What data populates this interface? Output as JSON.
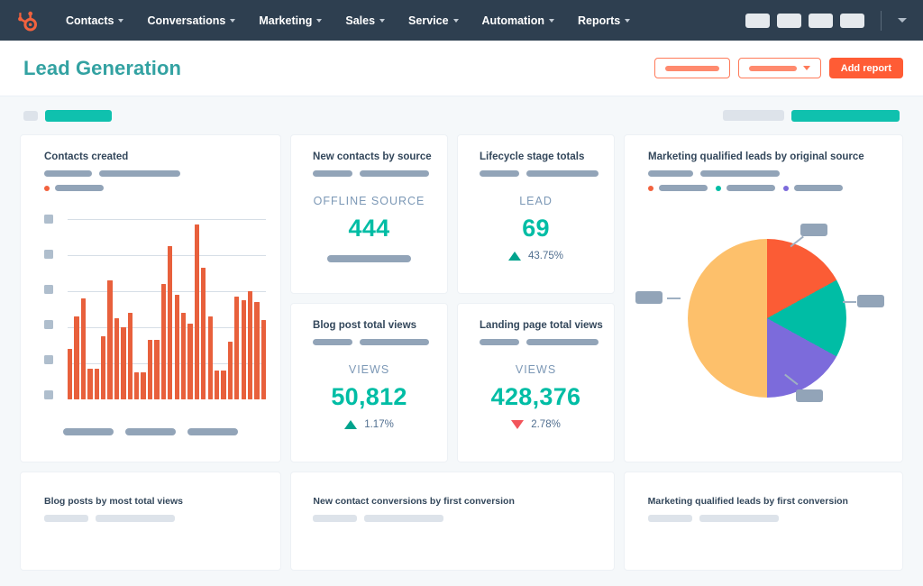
{
  "nav": {
    "logo_icon": "hubspot-sprocket-icon",
    "items": [
      {
        "label": "Contacts",
        "icon": "chevron-down-icon"
      },
      {
        "label": "Conversations",
        "icon": "chevron-down-icon"
      },
      {
        "label": "Marketing",
        "icon": "chevron-down-icon"
      },
      {
        "label": "Sales",
        "icon": "chevron-down-icon"
      },
      {
        "label": "Service",
        "icon": "chevron-down-icon"
      },
      {
        "label": "Automation",
        "icon": "chevron-down-icon"
      },
      {
        "label": "Reports",
        "icon": "chevron-down-icon"
      }
    ],
    "right_chip_count": 4,
    "account_chevron_icon": "chevron-down-icon",
    "background_color": "#2E3F50"
  },
  "header": {
    "title": "Lead Generation",
    "title_color": "#33A2A2",
    "actions": {
      "outline_button_1_label": "",
      "outline_button_2_label": "",
      "outline_button_2_icon": "caret-down-icon",
      "primary_button_label": "Add report",
      "primary_button_color": "#FF5C35"
    }
  },
  "filters": {
    "left": [
      {
        "type": "square",
        "color": "#DDE3EA"
      },
      {
        "type": "bar",
        "color": "#0FC1AE"
      }
    ],
    "right": [
      {
        "type": "bar",
        "color": "#DDE3EA"
      },
      {
        "type": "bar",
        "color": "#0FC1AE"
      }
    ]
  },
  "cards": {
    "contacts_created": {
      "title": "Contacts created",
      "legend_dot_color": "#F2623E"
    },
    "new_contacts_by_source": {
      "title": "New contacts by source",
      "kpi_label": "OFFLINE SOURCE",
      "kpi_value": "444"
    },
    "lifecycle_stage_totals": {
      "title": "Lifecycle stage totals",
      "kpi_label": "LEAD",
      "kpi_value": "69",
      "delta_value": "43.75%",
      "delta_direction": "up",
      "delta_color": "#00A38D"
    },
    "blog_post_total_views": {
      "title": "Blog post total views",
      "kpi_label": "VIEWS",
      "kpi_value": "50,812",
      "delta_value": "1.17%",
      "delta_direction": "up",
      "delta_color": "#00A38D"
    },
    "landing_page_total_views": {
      "title": "Landing page total views",
      "kpi_label": "VIEWS",
      "kpi_value": "428,376",
      "delta_value": "2.78%",
      "delta_direction": "down",
      "delta_color": "#F2545B"
    },
    "mql_by_original_source": {
      "title": "Marketing qualified leads by original source",
      "legend_dot_colors": [
        "#F2623E",
        "#00BDA5",
        "#7C6BDB"
      ]
    },
    "blog_posts_by_most_total_views": {
      "title": "Blog posts by most total views"
    },
    "new_contact_conversions": {
      "title": "New contact conversions by first conversion"
    },
    "mql_by_first_conversion": {
      "title": "Marketing qualified leads by first conversion"
    }
  },
  "chart_data": [
    {
      "type": "bar",
      "title": "Contacts created",
      "xlabel": "",
      "ylabel": "",
      "ylim": [
        0,
        100
      ],
      "grid": true,
      "legend_position": "top-left",
      "series": [
        {
          "name": "Contacts created",
          "color": "#E8603C",
          "values": [
            28,
            46,
            56,
            17,
            17,
            35,
            66,
            45,
            40,
            48,
            15,
            15,
            33,
            33,
            64,
            85,
            58,
            48,
            42,
            97,
            73,
            46,
            16,
            16,
            32,
            57,
            55,
            60,
            54,
            44
          ]
        }
      ],
      "ytick_labels": [
        "",
        "",
        "",
        "",
        "",
        ""
      ],
      "xtick_labels": [
        "",
        "",
        ""
      ]
    },
    {
      "type": "pie",
      "title": "Marketing qualified leads by original source",
      "legend_position": "top",
      "labels": [
        "",
        "",
        "",
        ""
      ],
      "values": [
        17,
        16,
        17,
        50
      ],
      "colors": [
        "#FB5C35",
        "#00BDA5",
        "#7C6BDB",
        "#FDC06B"
      ],
      "callout_labels": [
        "",
        "",
        "",
        ""
      ]
    }
  ]
}
